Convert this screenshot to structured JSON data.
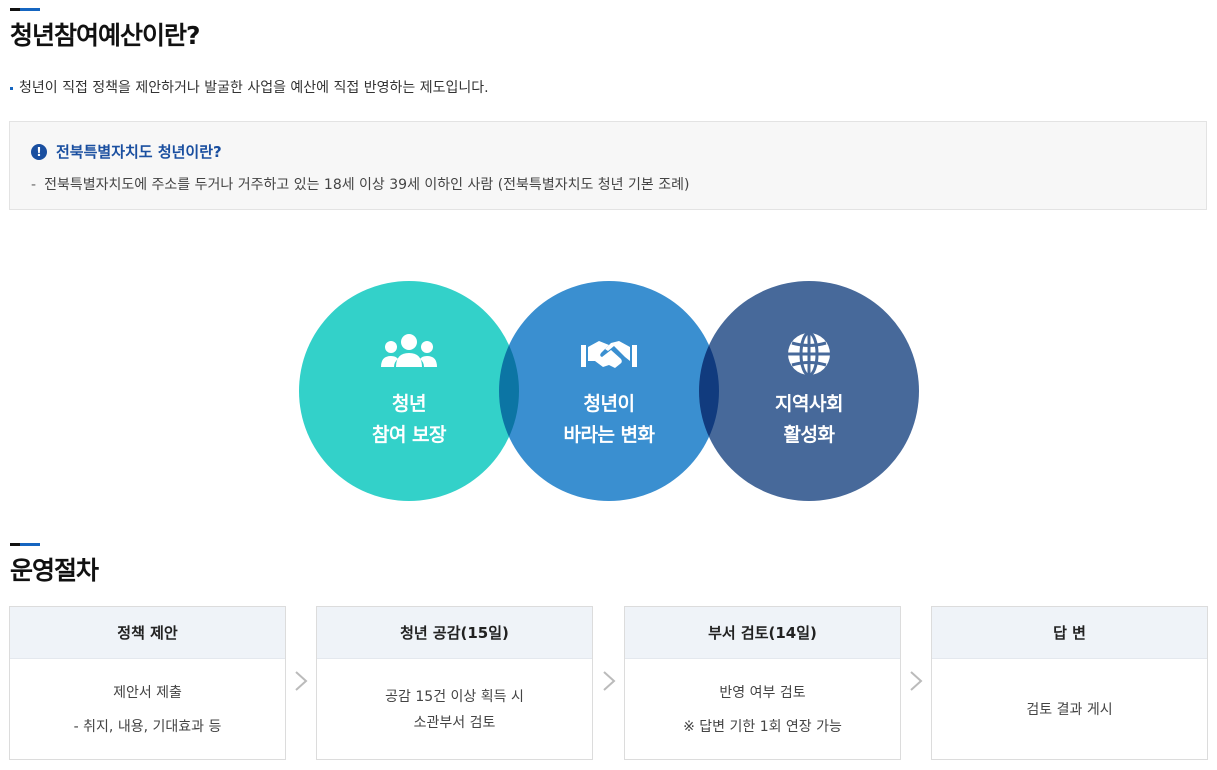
{
  "section1": {
    "title": "청년참여예산이란?",
    "intro": "청년이 직접 정책을 제안하거나 발굴한 사업을 예산에 직접 반영하는 제도입니다."
  },
  "info_box": {
    "title": "전북특별자치도 청년이란?",
    "dash": "-",
    "desc": "전북특별자치도에 주소를 두거나 거주하고 있는 18세 이상 39세 이하인 사람 (전북특별자치도 청년 기본 조례)"
  },
  "circles": [
    {
      "icon": "people-group-icon",
      "line1": "청년",
      "line2": "참여 보장",
      "color": "#33d1c9"
    },
    {
      "icon": "handshake-icon",
      "line1": "청년이",
      "line2": "바라는 변화",
      "color": "#3a8fd0"
    },
    {
      "icon": "globe-icon",
      "line1": "지역사회",
      "line2": "활성화",
      "color": "#47699a"
    }
  ],
  "section2": {
    "title": "운영절차"
  },
  "steps": [
    {
      "title": "정책 제안",
      "lines": [
        "제안서 제출",
        "- 취지, 내용, 기대효과 등"
      ]
    },
    {
      "title": "청년 공감(15일)",
      "lines": [
        "공감 15건 이상 획득 시",
        "소관부서 검토"
      ]
    },
    {
      "title": "부서 검토(14일)",
      "lines": [
        "반영 여부 검토",
        "※ 답변 기한 1회 연장 가능"
      ]
    },
    {
      "title": "답 변",
      "lines": [
        "검토 결과 게시"
      ]
    }
  ],
  "colors": {
    "accent": "#1565c0",
    "info_title": "#1a4fa0",
    "step_head_bg": "#eff3f8"
  }
}
